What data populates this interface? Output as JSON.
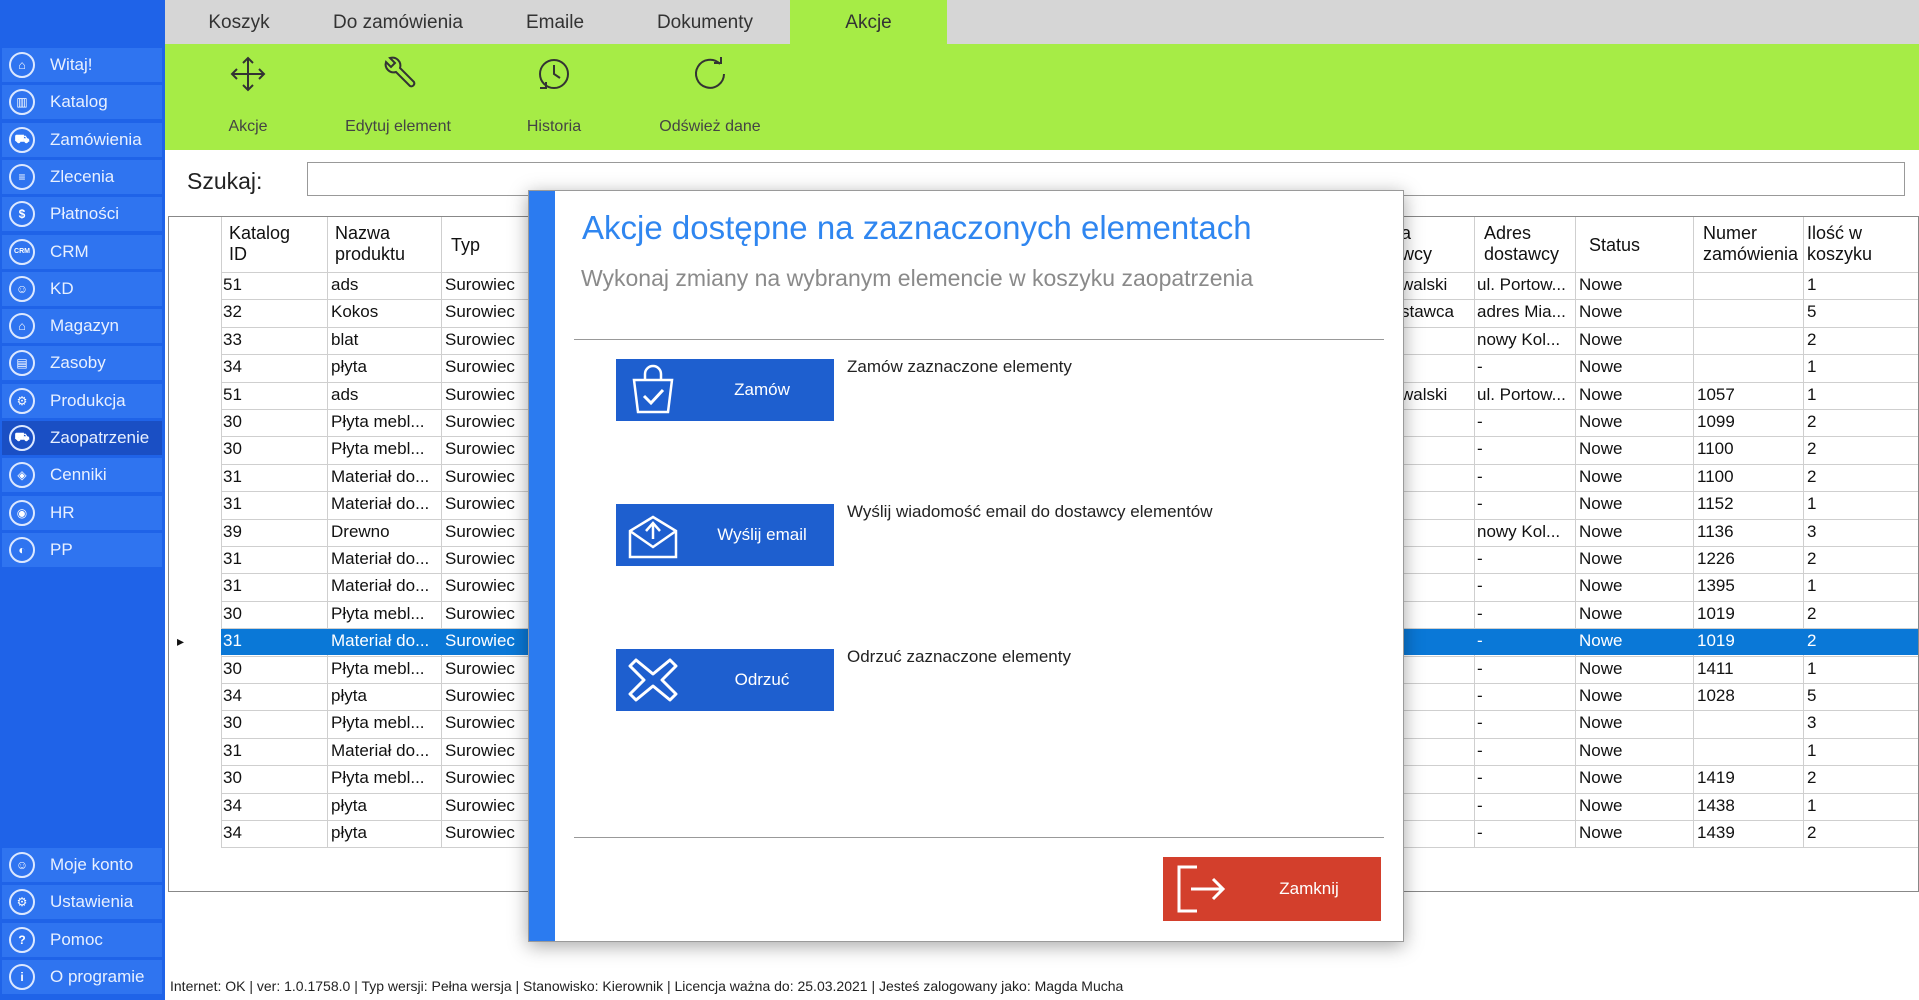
{
  "sidebar": {
    "items": [
      {
        "label": "Witaj!",
        "icon": "home-icon",
        "glyph": "⌂"
      },
      {
        "label": "Katalog",
        "icon": "book-icon",
        "glyph": "▥"
      },
      {
        "label": "Zamówienia",
        "icon": "cart-icon",
        "glyph": "⛟"
      },
      {
        "label": "Zlecenia",
        "icon": "list-icon",
        "glyph": "≡"
      },
      {
        "label": "Płatności",
        "icon": "dollar-icon",
        "glyph": "$"
      },
      {
        "label": "CRM",
        "icon": "crm-icon",
        "glyph": "CRM"
      },
      {
        "label": "KD",
        "icon": "person-icon",
        "glyph": "☺"
      },
      {
        "label": "Magazyn",
        "icon": "warehouse-icon",
        "glyph": "⌂"
      },
      {
        "label": "Zasoby",
        "icon": "resources-icon",
        "glyph": "▤"
      },
      {
        "label": "Produkcja",
        "icon": "production-icon",
        "glyph": "⚙"
      },
      {
        "label": "Zaopatrzenie",
        "icon": "supply-icon",
        "glyph": "⛟"
      },
      {
        "label": "Cenniki",
        "icon": "tag-icon",
        "glyph": "◈"
      },
      {
        "label": "HR",
        "icon": "hr-icon",
        "glyph": "◉"
      },
      {
        "label": "PP",
        "icon": "pp-icon",
        "glyph": "◐"
      }
    ],
    "bottom_items": [
      {
        "label": "Moje konto",
        "icon": "account-icon",
        "glyph": "☺"
      },
      {
        "label": "Ustawienia",
        "icon": "settings-icon",
        "glyph": "⚙"
      },
      {
        "label": "Pomoc",
        "icon": "help-icon",
        "glyph": "?"
      },
      {
        "label": "O programie",
        "icon": "info-icon",
        "glyph": "i"
      }
    ]
  },
  "tabs": [
    "Koszyk",
    "Do zamówienia",
    "Emaile",
    "Dokumenty",
    "Akcje"
  ],
  "ribbon": {
    "akcje": "Akcje",
    "edytuj": "Edytuj element",
    "historia": "Historia",
    "odswiez": "Odśwież dane"
  },
  "search": {
    "label": "Szukaj:",
    "value": ""
  },
  "table": {
    "headers": {
      "katalog_id": "Katalog ID",
      "nazwa": "Nazwa produktu",
      "typ": "Typ",
      "dostawca_partial": "a wcy",
      "adres": "Adres dostawcy",
      "status": "Status",
      "numer": "Numer zamówienia",
      "ilosc": "Ilość w koszyku"
    },
    "rows": [
      [
        "51",
        "ads",
        "Surowiec",
        "walski",
        "ul. Portow...",
        "Nowe",
        "",
        "1"
      ],
      [
        "32",
        "Kokos",
        "Surowiec",
        "stawca",
        "adres Mia...",
        "Nowe",
        "",
        "5"
      ],
      [
        "33",
        "blat",
        "Surowiec",
        "",
        "nowy Kol...",
        "Nowe",
        "",
        "2"
      ],
      [
        "34",
        "płyta",
        "Surowiec",
        "",
        "-",
        "Nowe",
        "",
        "1"
      ],
      [
        "51",
        "ads",
        "Surowiec",
        "walski",
        "ul. Portow...",
        "Nowe",
        "1057",
        "1"
      ],
      [
        "30",
        "Płyta mebl...",
        "Surowiec",
        "",
        "-",
        "Nowe",
        "1099",
        "2"
      ],
      [
        "30",
        "Płyta mebl...",
        "Surowiec",
        "",
        "-",
        "Nowe",
        "1100",
        "2"
      ],
      [
        "31",
        "Materiał do...",
        "Surowiec",
        "",
        "-",
        "Nowe",
        "1100",
        "2"
      ],
      [
        "31",
        "Materiał do...",
        "Surowiec",
        "",
        "-",
        "Nowe",
        "1152",
        "1"
      ],
      [
        "39",
        "Drewno",
        "Surowiec",
        "",
        "nowy Kol...",
        "Nowe",
        "1136",
        "3"
      ],
      [
        "31",
        "Materiał do...",
        "Surowiec",
        "",
        "-",
        "Nowe",
        "1226",
        "2"
      ],
      [
        "31",
        "Materiał do...",
        "Surowiec",
        "",
        "-",
        "Nowe",
        "1395",
        "1"
      ],
      [
        "30",
        "Płyta mebl...",
        "Surowiec",
        "",
        "-",
        "Nowe",
        "1019",
        "2"
      ],
      [
        "31",
        "Materiał do...",
        "Surowiec",
        "",
        "-",
        "Nowe",
        "1019",
        "2"
      ],
      [
        "30",
        "Płyta mebl...",
        "Surowiec",
        "",
        "-",
        "Nowe",
        "1411",
        "1"
      ],
      [
        "34",
        "płyta",
        "Surowiec",
        "",
        "-",
        "Nowe",
        "1028",
        "5"
      ],
      [
        "30",
        "Płyta mebl...",
        "Surowiec",
        "",
        "-",
        "Nowe",
        "",
        "3"
      ],
      [
        "31",
        "Materiał do...",
        "Surowiec",
        "",
        "-",
        "Nowe",
        "",
        "1"
      ],
      [
        "30",
        "Płyta mebl...",
        "Surowiec",
        "",
        "-",
        "Nowe",
        "1419",
        "2"
      ],
      [
        "34",
        "płyta",
        "Surowiec",
        "",
        "-",
        "Nowe",
        "1438",
        "1"
      ],
      [
        "34",
        "płyta",
        "Surowiec",
        "",
        "-",
        "Nowe",
        "1439",
        "2"
      ]
    ],
    "selected_row": 13
  },
  "modal": {
    "title": "Akcje dostępne na zaznaczonych elementach",
    "subtitle": "Wykonaj zmiany na wybranym elemencie w koszyku zaopatrzenia",
    "actions": [
      {
        "label": "Zamów",
        "description": "Zamów zaznaczone elementy"
      },
      {
        "label": "Wyślij email",
        "description": "Wyślij wiadomość email do dostawcy elementów"
      },
      {
        "label": "Odrzuć",
        "description": "Odrzuć zaznaczone elementy"
      }
    ],
    "close_label": "Zamknij"
  },
  "status_bar": "Internet: OK  |   ver: 1.0.1758.0   |   Typ wersji: Pełna wersja   |   Stanowisko: Kierownik   |   Licencja ważna do: 25.03.2021   |   Jesteś zalogowany jako: Magda Mucha",
  "colors": {
    "sidebar": "#1f63e8",
    "ribbon": "#a6ec46",
    "selection": "#0a78d7",
    "close_button": "#d33f2c",
    "action_button": "#1e5fcf"
  }
}
